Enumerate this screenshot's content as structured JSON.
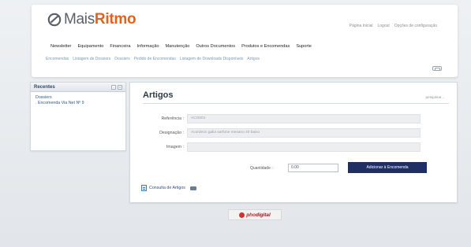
{
  "brand": {
    "mais": "Mais",
    "ritmo": "Ritmo",
    "accent": "#e3611a"
  },
  "top_links": [
    "Página Inicial",
    "Logout",
    "Opções de configuração"
  ],
  "main_nav": [
    "Newsletter",
    "Equipamento",
    "Financeira",
    "Informação",
    "Manutenção",
    "Outros Documentos",
    "Produtos e Encomendas",
    "Suporte"
  ],
  "sub_nav": [
    "Encomendas",
    "Listagem de Dossiers",
    "Dossiers",
    "Pedido de Encomendas",
    "Listagem de Downloads Disponíveis",
    "Artigos"
  ],
  "recent": {
    "title": "Recentes",
    "items": [
      "Dossiers",
      "Encomenda Via Net Nº 9"
    ]
  },
  "main": {
    "title": "Artigos",
    "search_link": "pesquisar...",
    "fields": [
      {
        "label": "Referência :",
        "value": "ACO001"
      },
      {
        "label": "Designação :",
        "value": "Acordeon galia sarfone mesano 40 baixo"
      },
      {
        "label": "Imagem :",
        "value": ""
      }
    ],
    "quantity_label": "Quantidade :",
    "quantity_value": "0.00",
    "add_button": "Adicionar à Encomenda",
    "consulta_link": "Consulta de Artigos"
  },
  "footer_logo": {
    "ph": "pho",
    "dig": "digital"
  }
}
